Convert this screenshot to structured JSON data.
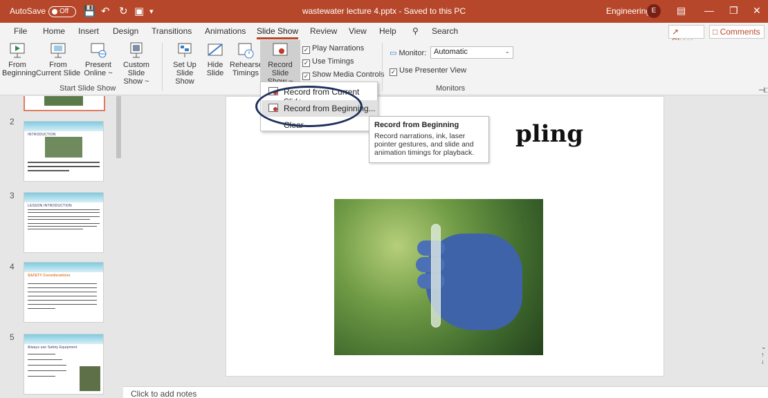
{
  "titlebar": {
    "autosave_label": "AutoSave",
    "autosave_state": "Off",
    "document_title": "wastewater lecture 4.pptx  -  Saved to this PC",
    "user_name": "Engineering",
    "user_initial": "E"
  },
  "tabs": [
    "File",
    "Home",
    "Insert",
    "Design",
    "Transitions",
    "Animations",
    "Slide Show",
    "Review",
    "View",
    "Help"
  ],
  "active_tab": "Slide Show",
  "search_label": "Search",
  "share_label": "Share",
  "comments_label": "Comments",
  "ribbon": {
    "start_group": {
      "label": "Start Slide Show",
      "from_beginning": [
        "From",
        "Beginning"
      ],
      "from_current": [
        "From",
        "Current Slide"
      ],
      "present_online": [
        "Present",
        "Online ~"
      ],
      "custom_show": [
        "Custom Slide",
        "Show ~"
      ]
    },
    "setup_group": {
      "setup": [
        "Set Up",
        "Slide Show"
      ],
      "hide": [
        "Hide",
        "Slide"
      ],
      "rehearse": [
        "Rehearse",
        "Timings"
      ],
      "record": [
        "Record Slide",
        "Show ~"
      ],
      "play_narrations": "Play Narrations",
      "use_timings": "Use Timings",
      "show_media_controls": "Show Media Controls"
    },
    "monitors_group": {
      "label": "Monitors",
      "monitor_label": "Monitor:",
      "monitor_value": "Automatic",
      "presenter_view": "Use Presenter View"
    }
  },
  "record_menu": {
    "items": [
      "Record from Current Slide...",
      "Record from Beginning...",
      "Clear"
    ]
  },
  "tooltip": {
    "title": "Record from Beginning",
    "body": "Record narrations, ink, laser pointer gestures, and slide and animation timings for playback."
  },
  "thumbnails": [
    {
      "number": "2",
      "title": "INTRODUCTION"
    },
    {
      "number": "3",
      "title": "LESSON INTRODUCTION"
    },
    {
      "number": "4",
      "title": "SAFETY Considerations"
    },
    {
      "number": "5",
      "title": "Always use Safety Equipment"
    }
  ],
  "slide": {
    "visible_title": "pling"
  },
  "notes_placeholder": "Click to add notes",
  "colors": {
    "accent": "#b7472a",
    "annotation_circle": "#1d2f5c"
  }
}
